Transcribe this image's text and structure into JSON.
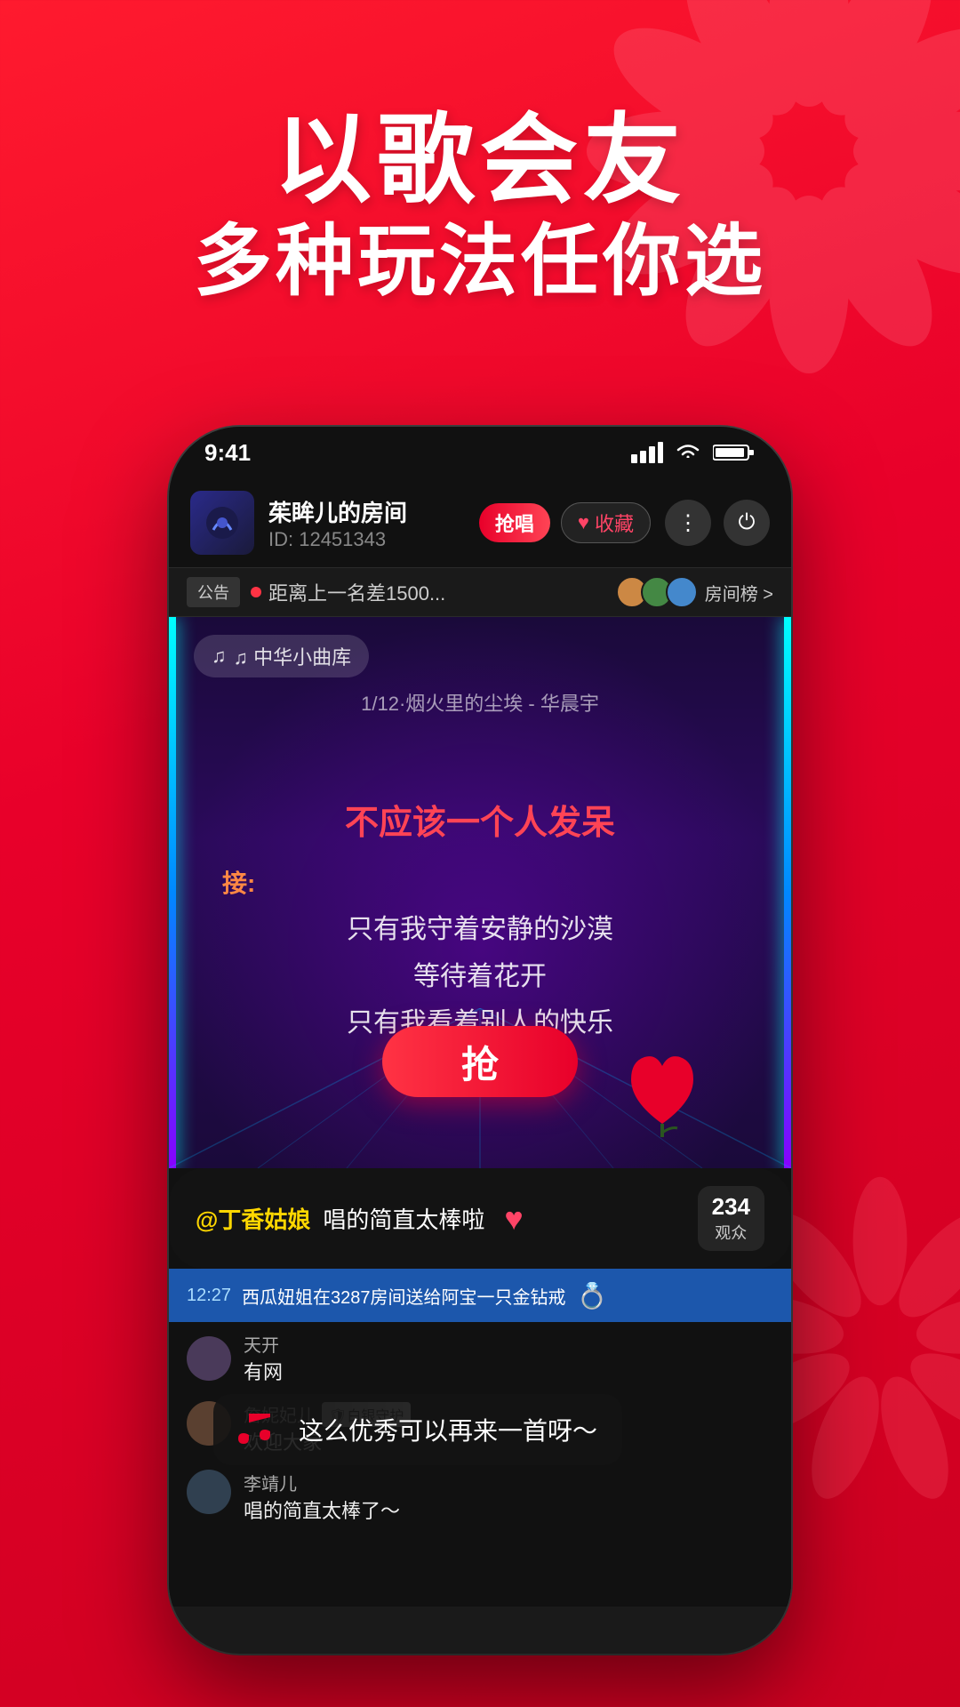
{
  "background": {
    "color_start": "#ff1a2e",
    "color_end": "#cc0020"
  },
  "hero": {
    "line1": "以歌会友",
    "line2": "多种玩法任你选"
  },
  "phone": {
    "status_bar": {
      "time": "9:41",
      "signal": "●●●●",
      "wifi": "wifi",
      "battery": "battery"
    },
    "room_header": {
      "avatar_emoji": "🎵",
      "room_name": "茱眸儿的房间",
      "room_id": "ID: 12451343",
      "badge_qiang": "抢唱",
      "badge_collect": "♥收藏"
    },
    "notice_bar": {
      "notice_label": "公告",
      "notice_text": "距离上一名差1500...",
      "rank_label": "房间榜 >"
    },
    "song_card": {
      "lib_badge": "♫ 中华小曲库",
      "song_number": "1/12·烟火里的尘埃 - 华晨宇",
      "current_lyric": "不应该一个人发呆",
      "next_label": "接:",
      "next_lines": [
        "只有我守着安静的沙漠",
        "等待着花开",
        "只有我看着别人的快乐"
      ],
      "grab_btn": "抢"
    },
    "chat_bubble": {
      "username": "@丁香姑娘",
      "text": " 唱的简直太棒啦"
    },
    "audience": {
      "count": "234",
      "label": "观众"
    },
    "gift_bar": {
      "time": "12:27",
      "text": "西瓜妞姐在3287房间送给阿宝一只金钻戒"
    },
    "music_popup": {
      "text": "这么优秀可以再来一首呀～"
    },
    "chat_messages": [
      {
        "avatar_color": "#556",
        "name": "天开",
        "text": "有网",
        "badge": ""
      },
      {
        "avatar_color": "#664",
        "name": "詹妮妃儿",
        "text": "欢迎大家",
        "badge": "白银守护"
      },
      {
        "avatar_color": "#466",
        "name": "李靖儿",
        "text": "唱的简直太棒了～",
        "badge": ""
      }
    ]
  }
}
